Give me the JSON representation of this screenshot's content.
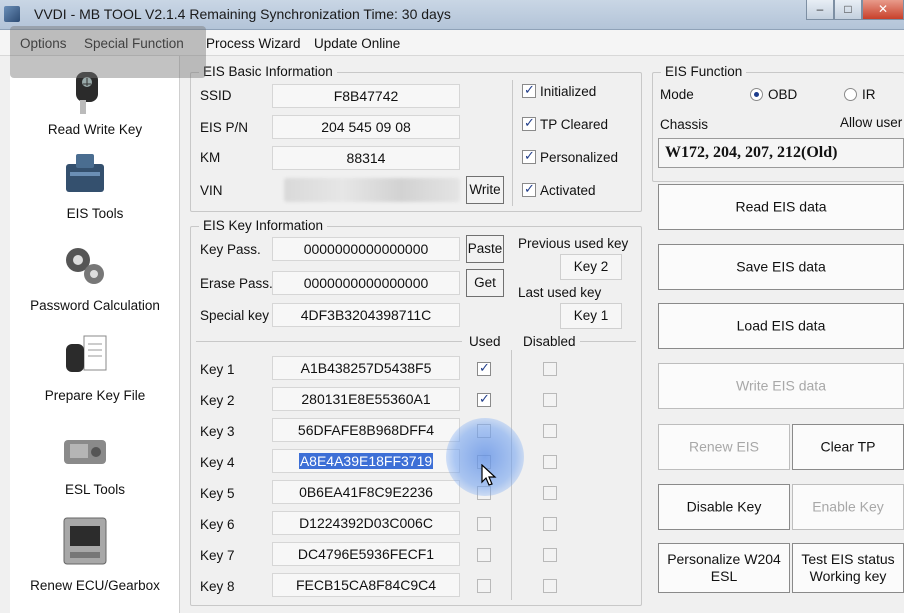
{
  "window": {
    "title": "VVDI - MB TOOL V2.1.4   Remaining Synchronization Time: 30 days",
    "minimize": "–",
    "maximize": "□",
    "close": "✕"
  },
  "menu": {
    "options": "Options",
    "special_function": "Special Function",
    "process_wizard": "Process Wizard",
    "update_online": "Update Online"
  },
  "sidebar": {
    "items": [
      {
        "label": "Read Write Key",
        "icon": "car-key-icon"
      },
      {
        "label": "EIS Tools",
        "icon": "eis-module-icon"
      },
      {
        "label": "Password Calculation",
        "icon": "gears-icon"
      },
      {
        "label": "Prepare Key File",
        "icon": "key-document-icon"
      },
      {
        "label": "ESL Tools",
        "icon": "steering-lock-icon"
      },
      {
        "label": "Renew ECU/Gearbox",
        "icon": "ecu-icon"
      }
    ]
  },
  "eis_basic": {
    "legend": "EIS Basic Information",
    "ssid_label": "SSID",
    "ssid": "F8B47742",
    "pn_label": "EIS P/N",
    "pn": "204 545 09 08",
    "km_label": "KM",
    "km": "88314",
    "vin_label": "VIN",
    "write_button": "Write",
    "flags": [
      {
        "label": "Initialized",
        "checked": true
      },
      {
        "label": "TP Cleared",
        "checked": true
      },
      {
        "label": "Personalized",
        "checked": true
      },
      {
        "label": "Activated",
        "checked": true
      }
    ]
  },
  "eis_key": {
    "legend": "EIS Key Information",
    "key_pass_label": "Key Pass.",
    "key_pass": "0000000000000000",
    "erase_pass_label": "Erase Pass.",
    "erase_pass": "0000000000000000",
    "special_key_label": "Special key",
    "special_key": "4DF3B3204398711C",
    "paste_button": "Paste",
    "get_button": "Get",
    "previous_used_label": "Previous used key",
    "previous_used": "Key 2",
    "last_used_label": "Last used key",
    "last_used": "Key 1",
    "used_header": "Used",
    "disabled_header": "Disabled",
    "keys": [
      {
        "label": "Key 1",
        "value": "A1B438257D5438F5",
        "used": true,
        "disabled": false
      },
      {
        "label": "Key 2",
        "value": "280131E8E55360A1",
        "used": true,
        "disabled": false
      },
      {
        "label": "Key 3",
        "value": "56DFAFE8B968DFF4",
        "used": false,
        "disabled": false
      },
      {
        "label": "Key 4",
        "value": "A8E4A39E18FF3719",
        "used": false,
        "disabled": false
      },
      {
        "label": "Key 5",
        "value": "0B6EA41F8C9E2236",
        "used": false,
        "disabled": false
      },
      {
        "label": "Key 6",
        "value": "D1224392D03C006C",
        "used": false,
        "disabled": false
      },
      {
        "label": "Key 7",
        "value": "DC4796E5936FECF1",
        "used": false,
        "disabled": false
      },
      {
        "label": "Key 8",
        "value": "FECB15CA8F84C9C4",
        "used": false,
        "disabled": false
      }
    ]
  },
  "eis_function": {
    "legend": "EIS Function",
    "mode_label": "Mode",
    "mode_obd": "OBD",
    "mode_ir": "IR",
    "mode_selected": "OBD",
    "chassis_label": "Chassis",
    "allow_user_label": "Allow user",
    "chassis_value": "W172, 204, 207, 212(Old)",
    "read_eis": "Read EIS data",
    "save_eis": "Save EIS data",
    "load_eis": "Load EIS data",
    "write_eis": "Write EIS data",
    "renew_eis": "Renew EIS",
    "clear_tp": "Clear TP",
    "disable_key": "Disable Key",
    "enable_key": "Enable Key",
    "personalize_l1": "Personalize W204",
    "personalize_l2": "ESL",
    "test_status_l1": "Test EIS status",
    "test_status_l2": "Working key"
  }
}
